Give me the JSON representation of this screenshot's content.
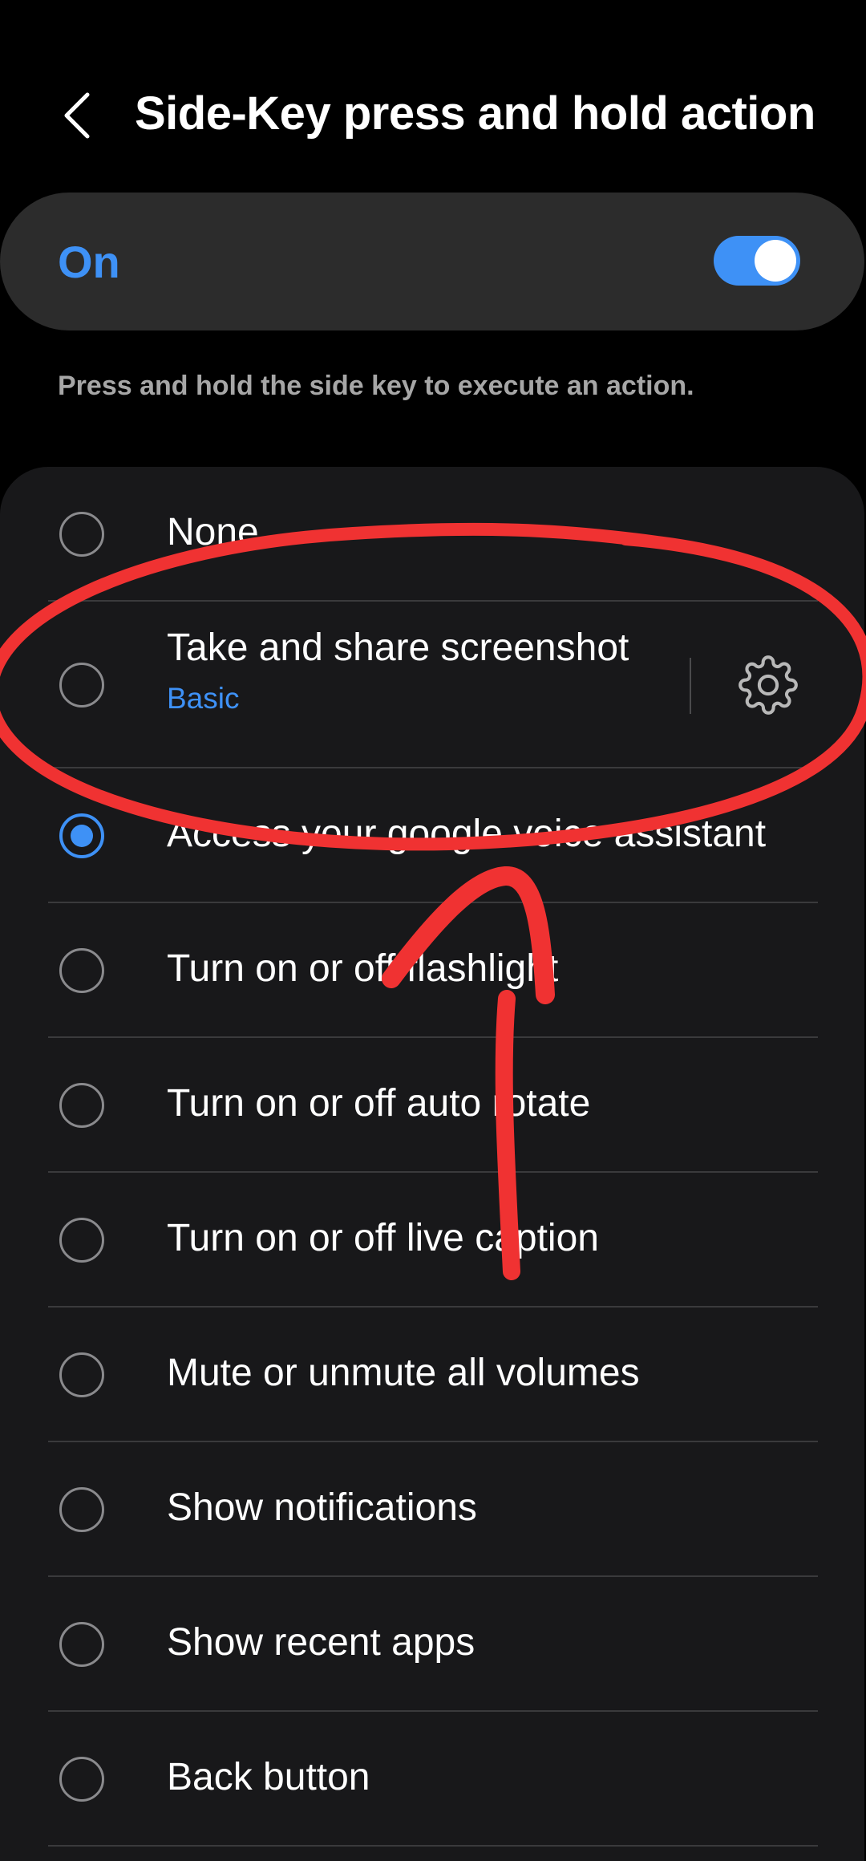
{
  "header": {
    "title": "Side-Key press and hold action",
    "back_icon": "chevron-left-icon"
  },
  "master_switch": {
    "label": "On",
    "state": true
  },
  "description": "Press and hold the side key to execute an action.",
  "options": [
    {
      "label": "None",
      "selected": false
    },
    {
      "label": "Take and share screenshot",
      "sublabel": "Basic",
      "selected": false,
      "settings_icon": "gear-icon"
    },
    {
      "label": "Access your google voice assistant",
      "selected": true
    },
    {
      "label": "Turn on or off flashlight",
      "selected": false
    },
    {
      "label": "Turn on or off auto rotate",
      "selected": false
    },
    {
      "label": "Turn on or off live caption",
      "selected": false
    },
    {
      "label": "Mute or unmute all volumes",
      "selected": false
    },
    {
      "label": "Show notifications",
      "selected": false
    },
    {
      "label": "Show recent apps",
      "selected": false
    },
    {
      "label": "Back button",
      "selected": false
    }
  ],
  "colors": {
    "accent": "#3e91f6",
    "background": "#000000",
    "card": "#18181a",
    "annotation": "#f03232"
  }
}
